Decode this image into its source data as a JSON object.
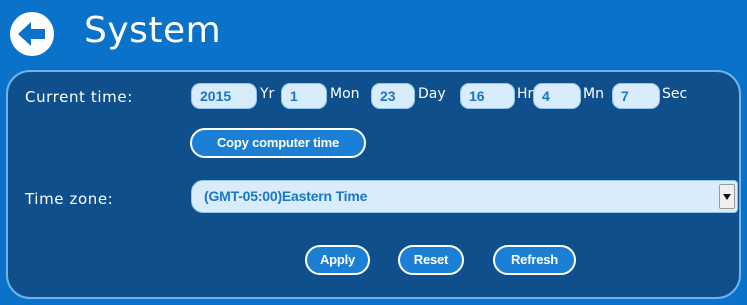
{
  "header": {
    "title": "System",
    "back_icon": "back-arrow-icon"
  },
  "current_time": {
    "label": "Current time:",
    "year": {
      "value": "2015",
      "unit": "Yr"
    },
    "month": {
      "value": "1",
      "unit": "Mon"
    },
    "day": {
      "value": "23",
      "unit": "Day"
    },
    "hour": {
      "value": "16",
      "unit": "Hr"
    },
    "minute": {
      "value": "4",
      "unit": "Mn"
    },
    "second": {
      "value": "7",
      "unit": "Sec"
    },
    "copy_button_label": "Copy computer time"
  },
  "time_zone": {
    "label": "Time zone:",
    "selected": "(GMT-05:00)Eastern Time"
  },
  "actions": {
    "apply_label": "Apply",
    "reset_label": "Reset",
    "refresh_label": "Refresh"
  },
  "colors": {
    "background": "#0a72c8",
    "panel": "#0f4f8c",
    "field": "#d8ecfb",
    "field_text": "#1877c9",
    "button": "#1c7fd6"
  }
}
